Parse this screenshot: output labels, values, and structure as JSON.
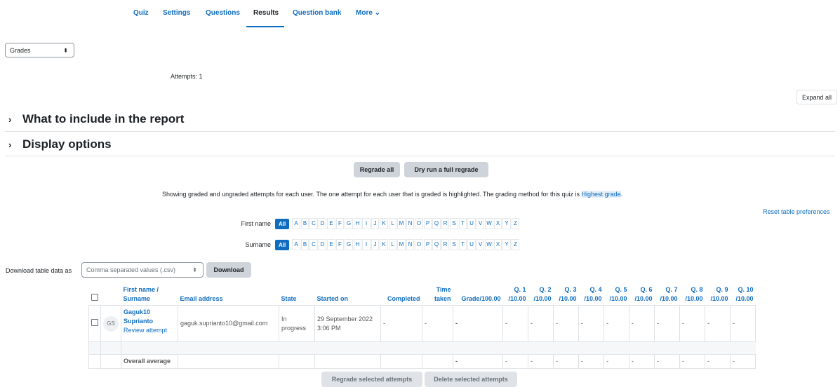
{
  "nav": {
    "tabs": [
      {
        "label": "Quiz"
      },
      {
        "label": "Settings"
      },
      {
        "label": "Questions"
      },
      {
        "label": "Results"
      },
      {
        "label": "Question bank"
      },
      {
        "label": "More ⌄"
      }
    ],
    "active": "Results"
  },
  "report_select": {
    "value": "Grades",
    "chevron": "⬍"
  },
  "attempts_label": "Attempts: 1",
  "expand_all": "Expand all",
  "sections": {
    "include": "What to include in the report",
    "display": "Display options"
  },
  "actions": {
    "regrade_all": "Regrade all",
    "dry_run": "Dry run a full regrade"
  },
  "info": {
    "text": "Showing graded and ungraded attempts for each user. The one attempt for each user that is graded is highlighted. The grading method for this quiz is ",
    "highlight": "Highest grade",
    "suffix": "."
  },
  "reset_prefs": "Reset table preferences",
  "initials": {
    "first_label": "First name",
    "last_label": "Surname",
    "all": "All",
    "letters": [
      "A",
      "B",
      "C",
      "D",
      "E",
      "F",
      "G",
      "H",
      "I",
      "J",
      "K",
      "L",
      "M",
      "N",
      "O",
      "P",
      "Q",
      "R",
      "S",
      "T",
      "U",
      "V",
      "W",
      "X",
      "Y",
      "Z"
    ]
  },
  "download": {
    "label": "Download table data as",
    "format": "Comma separated values (.csv)",
    "button": "Download"
  },
  "table": {
    "headers": {
      "name": "First name / Surname",
      "email": "Email address",
      "state": "State",
      "started": "Started on",
      "completed": "Completed",
      "time": "Time taken",
      "grade": "Grade/100.00",
      "questions": [
        "Q. 1 /10.00",
        "Q. 2 /10.00",
        "Q. 3 /10.00",
        "Q. 4 /10.00",
        "Q. 5 /10.00",
        "Q. 6 /10.00",
        "Q. 7 /10.00",
        "Q. 8 /10.00",
        "Q. 9 /10.00",
        "Q. 10 /10.00"
      ]
    },
    "row": {
      "initials": "GS",
      "name": "Gaguk10 Suprianto",
      "review": "Review attempt",
      "email": "gaguk.suprianto10@gmail.com",
      "state": "In progress",
      "started": "29 September 2022 3:06 PM",
      "completed": "-",
      "time": "-",
      "grade": "-",
      "q": [
        "-",
        "-",
        "-",
        "-",
        "-",
        "-",
        "-",
        "-",
        "-",
        "-"
      ]
    },
    "average": {
      "label": "Overall average",
      "grade": "-",
      "q": [
        "-",
        "-",
        "-",
        "-",
        "-",
        "-",
        "-",
        "-",
        "-",
        "-"
      ]
    }
  },
  "bottom_actions": {
    "regrade_selected": "Regrade selected attempts",
    "delete_selected": "Delete selected attempts"
  }
}
